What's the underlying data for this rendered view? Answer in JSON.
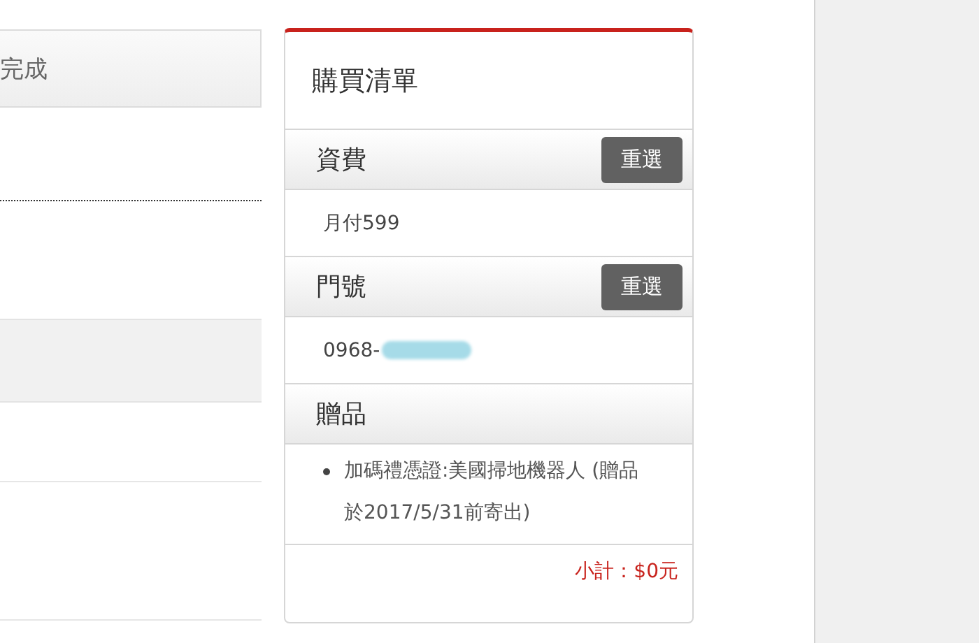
{
  "steps": {
    "current_label": "完成"
  },
  "cart": {
    "title": "購買清單",
    "sections": [
      {
        "heading": "資費",
        "reset_button": "重選",
        "kind": "text",
        "text": "月付599",
        "masked": false
      },
      {
        "heading": "門號",
        "reset_button": "重選",
        "kind": "text",
        "text": "0968-",
        "masked": true
      },
      {
        "heading": "贈品",
        "kind": "bullets",
        "items": [
          "加碼禮憑證:美國掃地機器人 (贈品於2017/5/31前寄出)"
        ]
      }
    ],
    "subtotal": "小計：$0元"
  }
}
